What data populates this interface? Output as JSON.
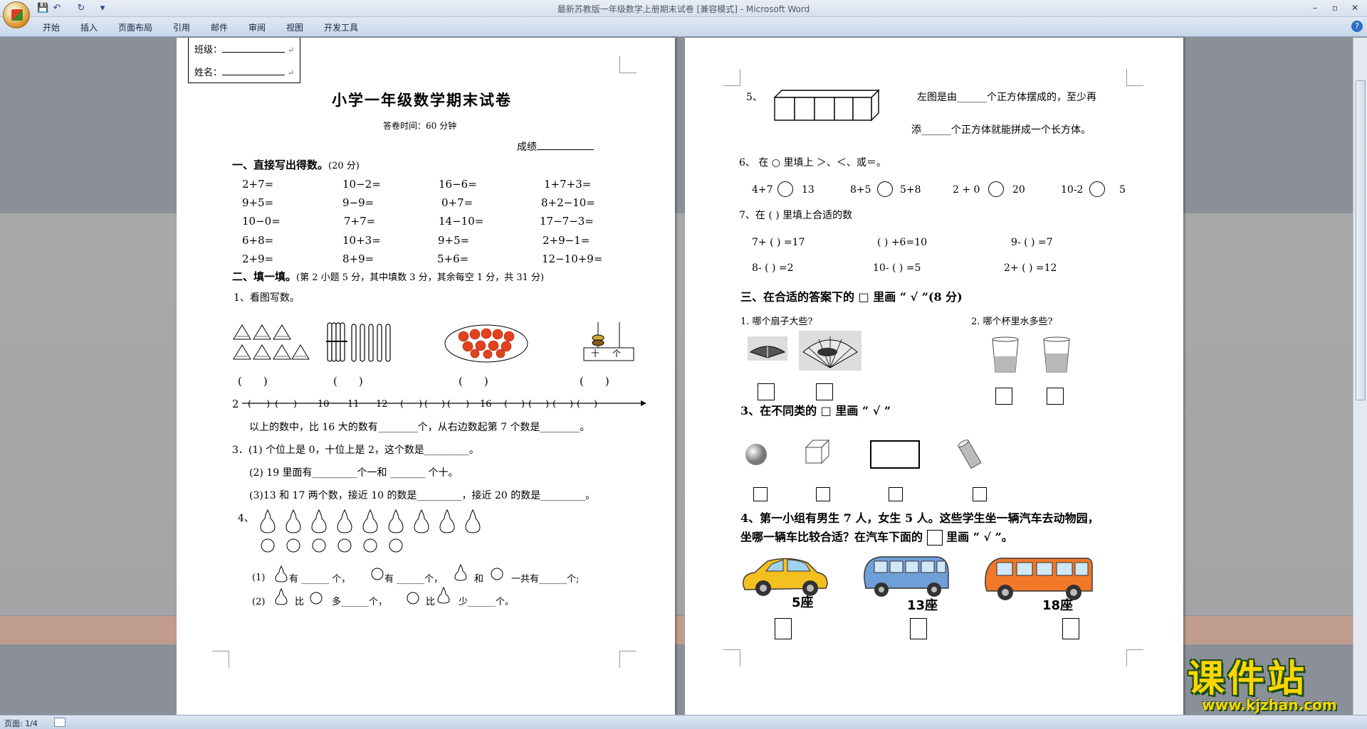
{
  "window": {
    "title": "最新苏教版一年级数学上册期末试卷 [兼容模式] - Microsoft Word",
    "controls": {
      "minimize": "–",
      "restore": "▫",
      "close": "✕"
    }
  },
  "quick_access": {
    "save_icon": "save-icon",
    "undo_icon": "undo-icon",
    "redo_icon": "redo-icon",
    "customize": "▾"
  },
  "ribbon": {
    "tabs": [
      "开始",
      "插入",
      "页面布局",
      "引用",
      "邮件",
      "审阅",
      "视图",
      "开发工具"
    ],
    "help": "?"
  },
  "status": {
    "page": "页面: 1/4"
  },
  "page1": {
    "class_label": "班级：",
    "name_label": "姓名：",
    "title": "小学一年级数学期末试卷",
    "time": "答卷时间：60 分钟",
    "score": "成绩",
    "sec1": "一、直接写出得数。",
    "sec1_pts": "(20 分)",
    "arith": [
      [
        "2+7=",
        "10−2=",
        "16−6=",
        "1+7+3="
      ],
      [
        "9+5=",
        "9−9=",
        "0+7=",
        "8+2−10="
      ],
      [
        "10−0=",
        "7+7=",
        "14−10=",
        "17−7−3="
      ],
      [
        "6+8=",
        "10+3=",
        "9+5=",
        "2+9−1="
      ],
      [
        "2+9=",
        "8+9=",
        "5+6=",
        "12−10+9="
      ]
    ],
    "sec2": "二、填一填。",
    "sec2_note": "(第 2 小题 5 分，其中填数 3 分，其余每空 1 分，共 31 分)",
    "q1": "1、看图写数。",
    "paren": "(　　)",
    "abacus_labels": [
      "十",
      "个"
    ],
    "q2_num": "2",
    "numline": [
      "(",
      ")",
      "(",
      ")",
      "10",
      "11",
      "12",
      "(",
      ")",
      "(",
      ")",
      "(",
      ")",
      "16",
      "(",
      ")",
      "(",
      ")",
      "(",
      ")",
      "(",
      ")"
    ],
    "q2_text": "以上的数中，比 16 大的数有________个，从右边数起第 7 个数是________。",
    "q3_1": "3．(1) 个位上是 0，十位上是 2，这个数是_________。",
    "q3_2": "(2) 19 里面有_________个一和 _______ 个十。",
    "q3_3": "(3)13 和 17 两个数，接近 10 的数是_________，接近 20 的数是_________。",
    "q4_num": "4、",
    "q4_1_lab": "(1)",
    "q4_1": [
      "有 ______ 个，",
      "有 ______个，",
      "和",
      "一共有______个;"
    ],
    "q4_2_lab": "(2)",
    "q4_2": [
      "比",
      "多______个，",
      "比",
      "少______个。"
    ]
  },
  "page2": {
    "q5_num": "5、",
    "q5_a": "左图是由______个正方体摆成的，至少再",
    "q5_b": "添______个正方体就能拼成一个长方体。",
    "q6": "6、 在 ○ 里填上 ＞、＜、或＝。",
    "cmp": [
      [
        "4+7",
        "13"
      ],
      [
        "8+5",
        "5+8"
      ],
      [
        "2 + 0",
        "20"
      ],
      [
        "10-2",
        "5"
      ]
    ],
    "q7": "7、在 (  ) 里填上合适的数",
    "fill": [
      [
        "7+ (    ) =17",
        "(    ) +6=10",
        "9- (    ) =7"
      ],
      [
        "8- (    ) =2",
        "10- (    ) =5",
        "2+ (    ) =12"
      ]
    ],
    "sec3": "三、在合适的答案下的 □ 里画 “ √ ”(8 分)",
    "s3q1": "1. 哪个扇子大些?",
    "s3q2": "2. 哪个杯里水多些?",
    "s3q3": "3、在不同类的 □ 里画 “ √ ”",
    "s3q4a": "4、第一小组有男生 7 人，女生 5 人。这些学生坐一辆汽车去动物园，",
    "s3q4b": "坐哪一辆车比较合适？在汽车下面的",
    "s3q4c": "里画 “ √ ”。",
    "cars": [
      "5座",
      "13座",
      "18座"
    ]
  },
  "watermark": {
    "main": "课件站",
    "url": "www.kjzhan.com"
  }
}
